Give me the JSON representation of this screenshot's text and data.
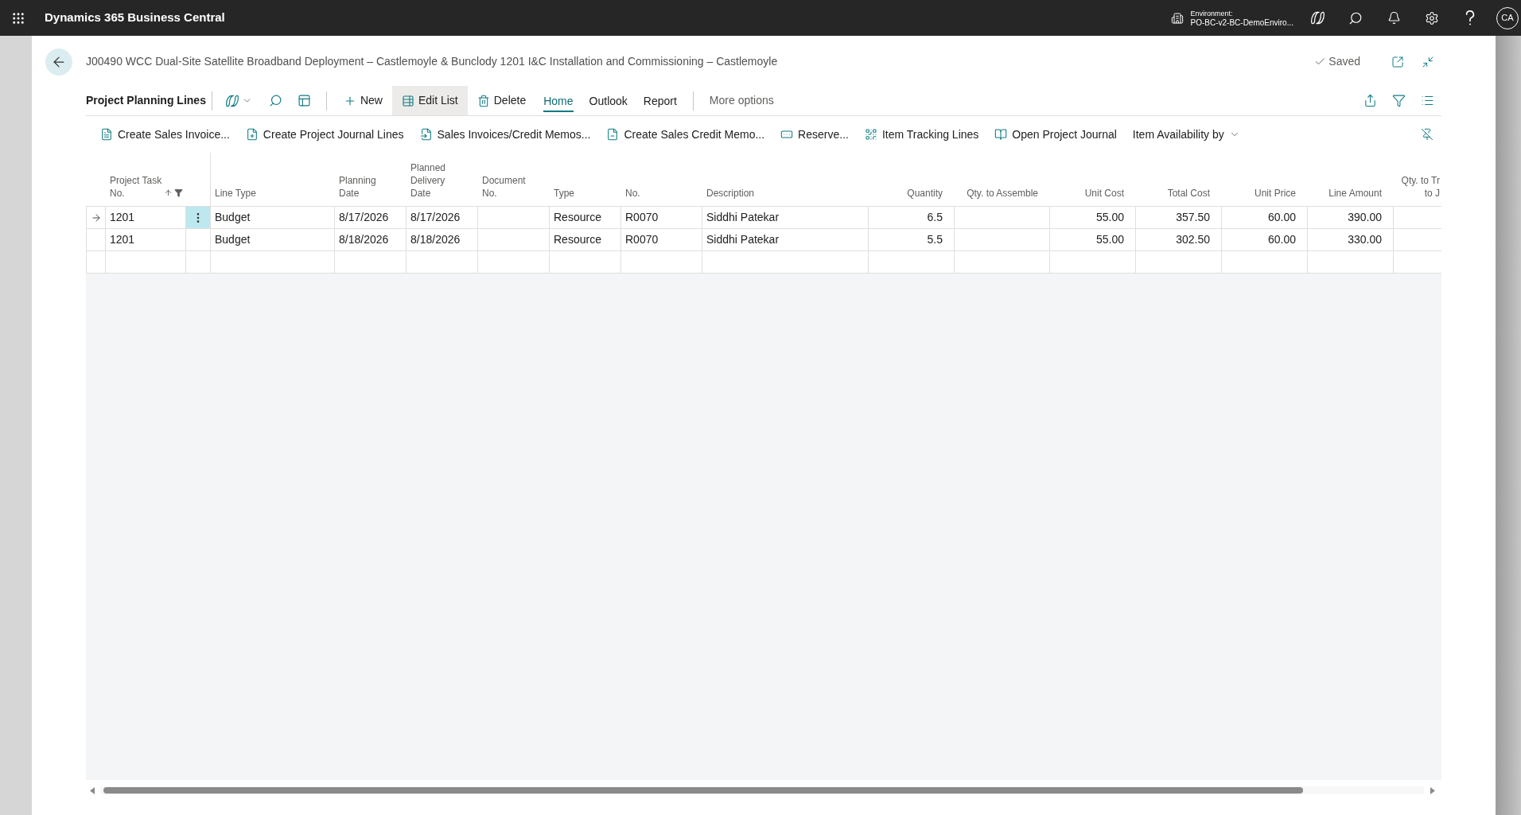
{
  "top_bar": {
    "app_title": "Dynamics 365 Business Central",
    "environment": {
      "label": "Environment:",
      "name": "PO-BC-v2-BC-DemoEnviro..."
    },
    "avatar": "CA"
  },
  "page": {
    "title": "J00490 WCC Dual-Site Satellite Broadband Deployment – Castlemoyle & Bunclody 1201 I&C Installation and Commissioning – Castlemoyle",
    "status": "Saved"
  },
  "action_bar": {
    "title": "Project Planning Lines",
    "actions": [
      {
        "label": "New",
        "active": false
      },
      {
        "label": "Edit List",
        "active": true
      },
      {
        "label": "Delete",
        "active": false
      }
    ],
    "tabs": [
      {
        "label": "Home",
        "selected": true
      },
      {
        "label": "Outlook",
        "selected": false
      },
      {
        "label": "Report",
        "selected": false
      }
    ],
    "more": "More options"
  },
  "home_actions": [
    {
      "label": "Create Sales Invoice...",
      "kind": "button"
    },
    {
      "label": "Create Project Journal Lines",
      "kind": "button"
    },
    {
      "label": "Sales Invoices/Credit Memos...",
      "kind": "button"
    },
    {
      "label": "Create Sales Credit Memo...",
      "kind": "button"
    },
    {
      "label": "Reserve...",
      "kind": "button"
    },
    {
      "label": "Item Tracking Lines",
      "kind": "button"
    },
    {
      "label": "Open Project Journal",
      "kind": "button"
    },
    {
      "label": "Item Availability by",
      "kind": "dropdown"
    }
  ],
  "table": {
    "columns": [
      {
        "label": "Project Task\nNo.",
        "sorted": true,
        "filtered": true
      },
      {
        "label": "Line Type",
        "sorted": false,
        "filtered": false
      },
      {
        "label": "Planning\nDate",
        "sorted": false,
        "filtered": false
      },
      {
        "label": "Planned\nDelivery\nDate",
        "sorted": false,
        "filtered": false
      },
      {
        "label": "Document\nNo.",
        "sorted": false,
        "filtered": false
      },
      {
        "label": "Type",
        "sorted": false,
        "filtered": false
      },
      {
        "label": "No.",
        "sorted": false,
        "filtered": false
      },
      {
        "label": "Description",
        "sorted": false,
        "filtered": false
      },
      {
        "label": "Quantity",
        "sorted": false,
        "filtered": false
      },
      {
        "label": "Qty. to Assemble",
        "sorted": false,
        "filtered": false
      },
      {
        "label": "Unit Cost",
        "sorted": false,
        "filtered": false
      },
      {
        "label": "Total Cost",
        "sorted": false,
        "filtered": false
      },
      {
        "label": "Unit Price",
        "sorted": false,
        "filtered": false
      },
      {
        "label": "Line Amount",
        "sorted": false,
        "filtered": false
      },
      {
        "label": "Qty. to Tr\nto J",
        "sorted": false,
        "filtered": false
      }
    ],
    "rows": [
      {
        "selected": true,
        "project_task_no": "1201",
        "line_type": "Budget",
        "planning_date": "8/17/2026",
        "planned_delivery_date": "8/17/2026",
        "type": "Resource",
        "no": "R0070",
        "description": "Siddhi Patekar",
        "quantity": "6.5",
        "unit_cost": "55.00",
        "total_cost": "357.50",
        "unit_price": "60.00",
        "line_amount": "390.00"
      },
      {
        "selected": false,
        "project_task_no": "1201",
        "line_type": "Budget",
        "planning_date": "8/18/2026",
        "planned_delivery_date": "8/18/2026",
        "type": "Resource",
        "no": "R0070",
        "description": "Siddhi Patekar",
        "quantity": "5.5",
        "unit_cost": "55.00",
        "total_cost": "302.50",
        "unit_price": "60.00",
        "line_amount": "330.00"
      }
    ]
  }
}
